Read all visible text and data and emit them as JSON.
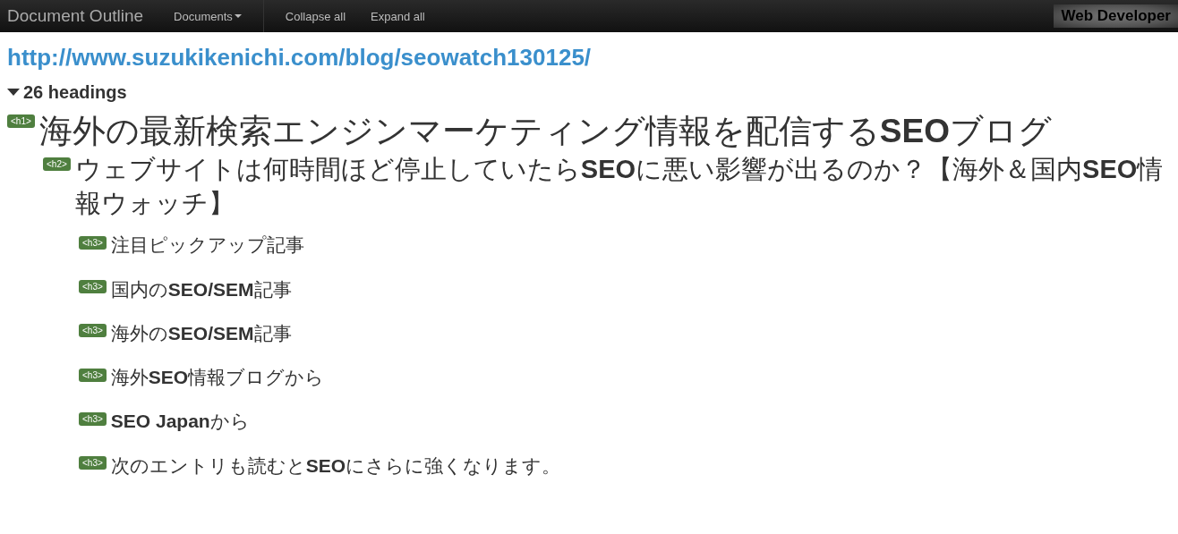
{
  "navbar": {
    "brand": "Document Outline",
    "menu": {
      "label": "Documents"
    },
    "actions": [
      "Collapse all",
      "Expand all"
    ],
    "tool_name": "Web Developer"
  },
  "document": {
    "url": "http://www.suzukikenichi.com/blog/seowatch130125/",
    "summary": {
      "label": "26 headings",
      "expanded": true
    },
    "headings": [
      {
        "tag": "<h1>",
        "text": "海外の最新検索エンジンマーケティング情報を配信する**SEO**ブログ",
        "children": [
          {
            "tag": "<h2>",
            "text": "ウェブサイトは何時間ほど停止していたら**SEO**に悪い影響が出るのか？【海外＆国内**SEO**情報ウォッチ】",
            "children": [
              {
                "tag": "<h3>",
                "text": "注目ピックアップ記事"
              },
              {
                "tag": "<h3>",
                "text": "国内の**SEO/SEM**記事"
              },
              {
                "tag": "<h3>",
                "text": "海外の**SEO/SEM**記事"
              },
              {
                "tag": "<h3>",
                "text": "海外**SEO**情報ブログから"
              },
              {
                "tag": "<h3>",
                "text": "**SEO Japan**から"
              },
              {
                "tag": "<h3>",
                "text": "次のエントリも読むと**SEO**にさらに強くなります。"
              }
            ]
          }
        ]
      }
    ]
  }
}
